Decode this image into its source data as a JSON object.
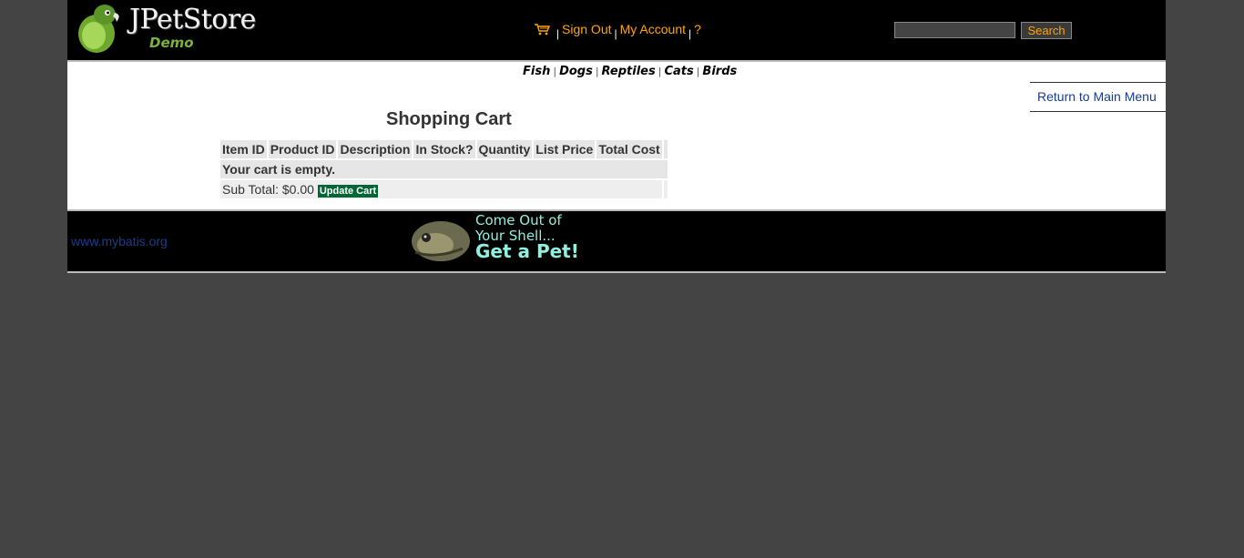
{
  "header": {
    "logo_title": "JPetStore",
    "logo_subtitle": "Demo",
    "cart_icon": "shopping-cart-icon",
    "menu": {
      "sign_out": "Sign Out",
      "my_account": "My Account",
      "help": "?",
      "separator": "|"
    },
    "search": {
      "value": "",
      "button_label": "Search"
    }
  },
  "quicklinks": {
    "items": [
      "Fish",
      "Dogs",
      "Reptiles",
      "Cats",
      "Birds"
    ],
    "separator": "|"
  },
  "back_link": "Return to Main Menu",
  "cart": {
    "title": "Shopping Cart",
    "columns": [
      "Item ID",
      "Product ID",
      "Description",
      "In Stock?",
      "Quantity",
      "List Price",
      "Total Cost"
    ],
    "empty_message": "Your cart is empty.",
    "subtotal_label": "Sub Total: $0.00",
    "update_button": "Update Cart"
  },
  "footer": {
    "link": "www.mybatis.org",
    "banner_line1": "Come Out of",
    "banner_line2": "Your Shell...",
    "banner_line3": "Get a Pet!"
  },
  "colors": {
    "accent": "#ffa500",
    "background": "#444444",
    "header": "#000000",
    "button_green": "#006633",
    "link": "#1a3c8c"
  }
}
